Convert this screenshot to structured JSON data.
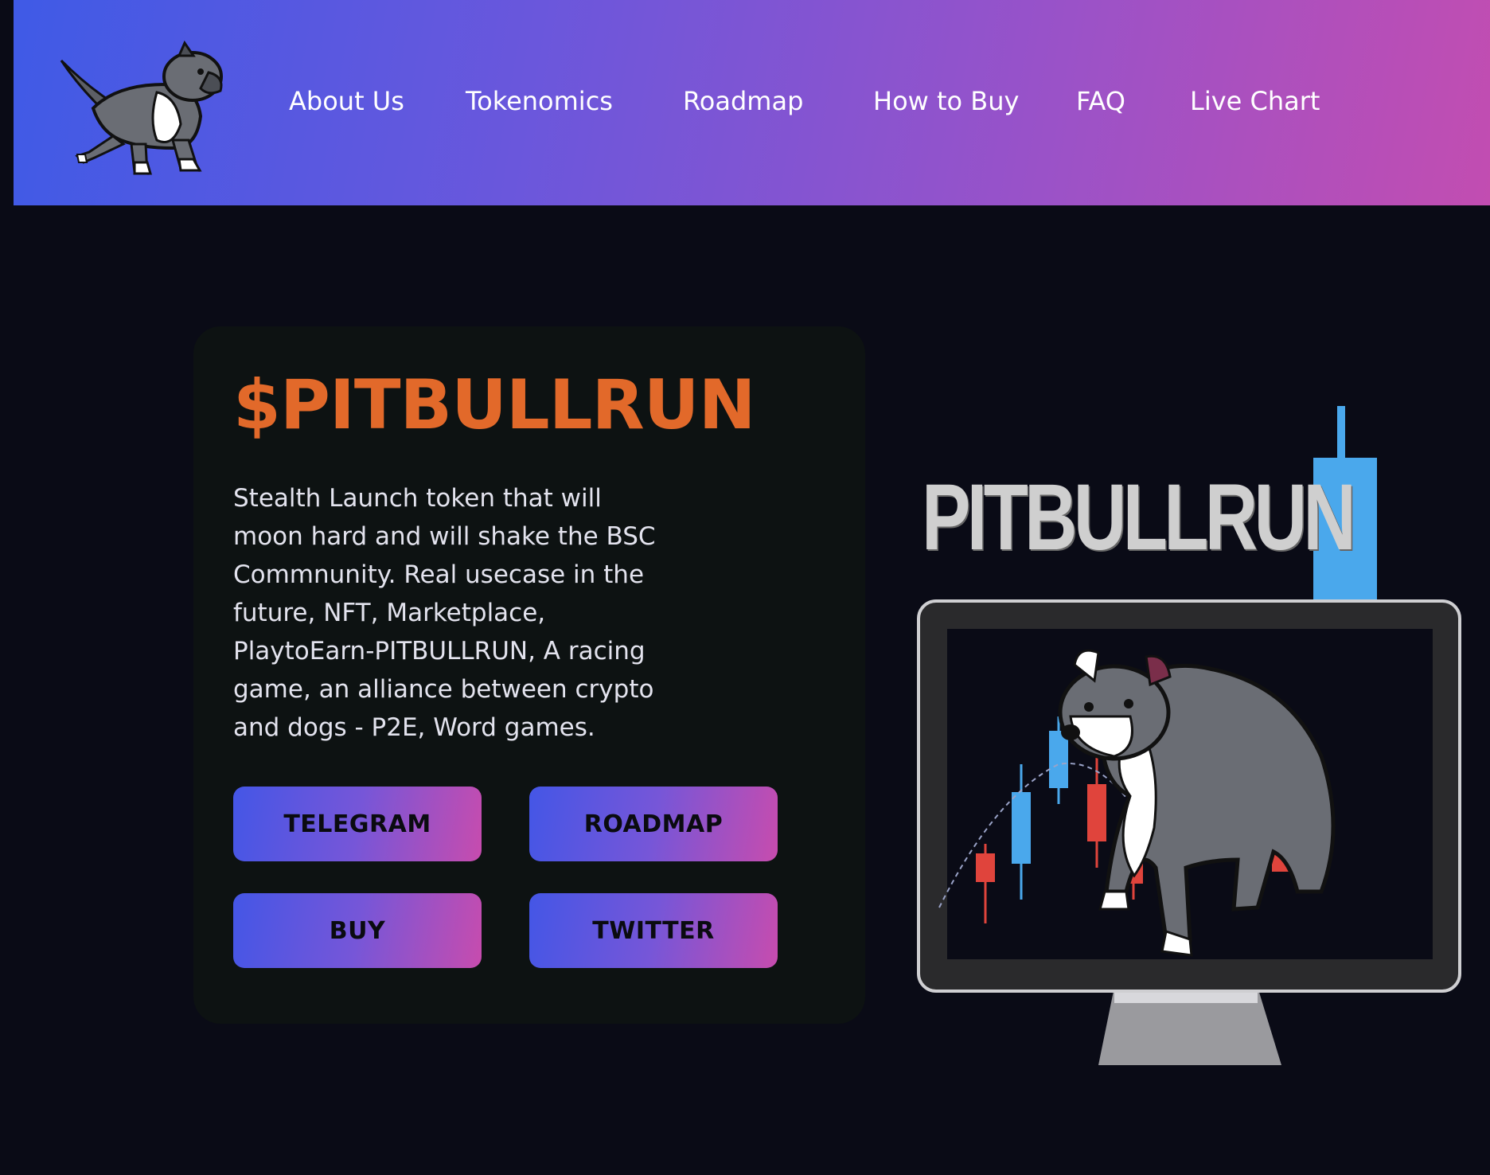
{
  "nav": {
    "items": [
      "About Us",
      "Tokenomics",
      "Roadmap",
      "How to Buy",
      "FAQ",
      "Live Chart"
    ]
  },
  "hero": {
    "title": "$PITBULLRUN",
    "description": "Stealth Launch token that will moon hard and will shake the BSC Commnunity. Real usecase in the future, NFT, Marketplace, PlaytoEarn-PITBULLRUN, A racing game, an alliance between crypto and dogs - P2E, Word games.",
    "buttons": {
      "telegram": "TELEGRAM",
      "roadmap": "ROADMAP",
      "buy": "BUY",
      "twitter": "TWITTER"
    },
    "illustration_text": "PITBULLRUN"
  },
  "colors": {
    "header_gradient_start": "#3f5ae6",
    "header_gradient_end": "#c24db1",
    "page_background": "#0a0b16",
    "card_background": "#0d1212",
    "title_accent": "#e2692a",
    "candle_up": "#4aa8ec",
    "candle_down": "#e0443c"
  },
  "icons": {
    "logo": "pitbull-dog-logo",
    "illustration": "pitbull-on-monitor-candlestick-chart"
  }
}
